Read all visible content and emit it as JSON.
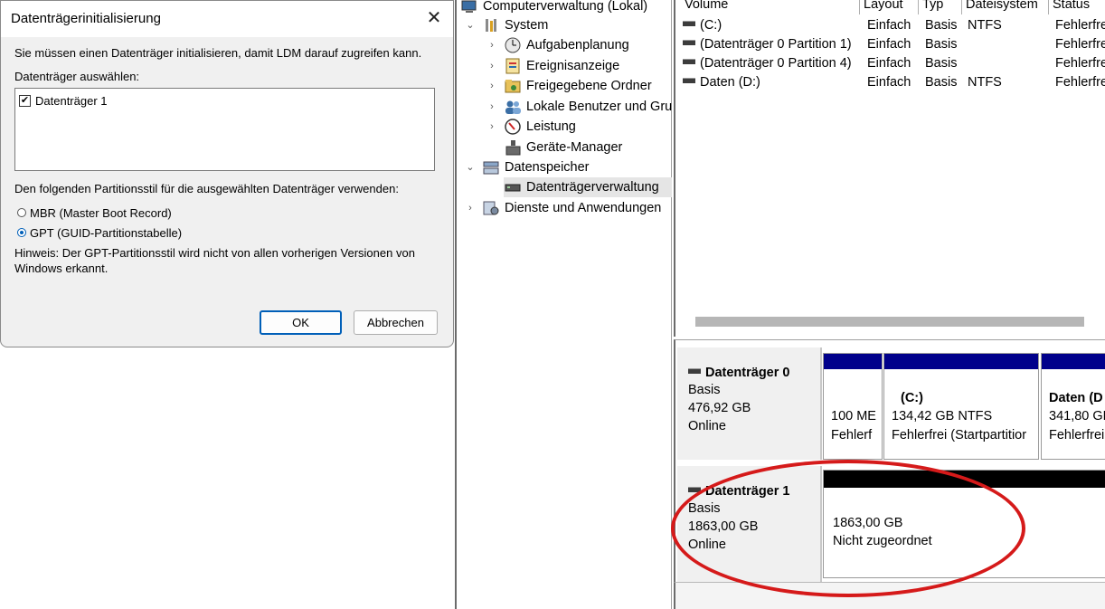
{
  "dialog": {
    "title": "Datenträgerinitialisierung",
    "close_glyph": "✕",
    "intro": "Sie müssen einen Datenträger initialisieren, damit LDM darauf zugreifen kann.",
    "select_label": "Datenträger auswählen:",
    "disk_item": "Datenträger 1",
    "disk_checked": true,
    "partition_style_label": "Den folgenden Partitionsstil für die ausgewählten Datenträger verwenden:",
    "option_mbr": "MBR (Master Boot Record)",
    "option_gpt": "GPT (GUID-Partitionstabelle)",
    "selected_option": "gpt",
    "hint_line1": "Hinweis: Der GPT-Partitionsstil wird nicht von allen vorherigen Versionen von",
    "hint_line2": "Windows erkannt.",
    "ok_label": "OK",
    "cancel_label": "Abbrechen"
  },
  "tree": {
    "root": "Computerverwaltung (Lokal)",
    "system": "System",
    "task_scheduler": "Aufgabenplanung",
    "event_viewer": "Ereignisanzeige",
    "shared_folders": "Freigegebene Ordner",
    "local_users": "Lokale Benutzer und Gru",
    "performance": "Leistung",
    "device_manager": "Geräte-Manager",
    "storage": "Datenspeicher",
    "disk_management": "Datenträgerverwaltung",
    "services": "Dienste und Anwendungen"
  },
  "volumes": {
    "headers": {
      "volume": "Volume",
      "layout": "Layout",
      "type": "Typ",
      "filesystem": "Dateisystem",
      "status": "Status"
    },
    "rows": [
      {
        "volume": "(C:)",
        "layout": "Einfach",
        "type": "Basis",
        "filesystem": "NTFS",
        "status": "Fehlerfre"
      },
      {
        "volume": "(Datenträger 0 Partition 1)",
        "layout": "Einfach",
        "type": "Basis",
        "filesystem": "",
        "status": "Fehlerfre"
      },
      {
        "volume": "(Datenträger 0 Partition 4)",
        "layout": "Einfach",
        "type": "Basis",
        "filesystem": "",
        "status": "Fehlerfre"
      },
      {
        "volume": "Daten (D:)",
        "layout": "Einfach",
        "type": "Basis",
        "filesystem": "NTFS",
        "status": "Fehlerfre"
      }
    ]
  },
  "disks": [
    {
      "name": "Datenträger 0",
      "type": "Basis",
      "size": "476,92 GB",
      "state": "Online",
      "partitions": [
        {
          "title": "",
          "size": "100 ME",
          "status": "Fehlerf"
        },
        {
          "title": "(C:)",
          "size": "134,42 GB NTFS",
          "status": "Fehlerfrei (Startpartitior"
        },
        {
          "title": "Daten  (D",
          "size": "341,80 GE",
          "status": "Fehlerfrei"
        }
      ]
    },
    {
      "name": "Datenträger 1",
      "type": "Basis",
      "size": "1863,00 GB",
      "state": "Online",
      "partitions": [
        {
          "title": "",
          "size": "1863,00 GB",
          "status": "Nicht zugeordnet"
        }
      ]
    }
  ],
  "colors": {
    "primary_partition": "#00008b",
    "unallocated": "#000000",
    "annotation_circle": "#d51a1a",
    "accent": "#005fb8"
  }
}
